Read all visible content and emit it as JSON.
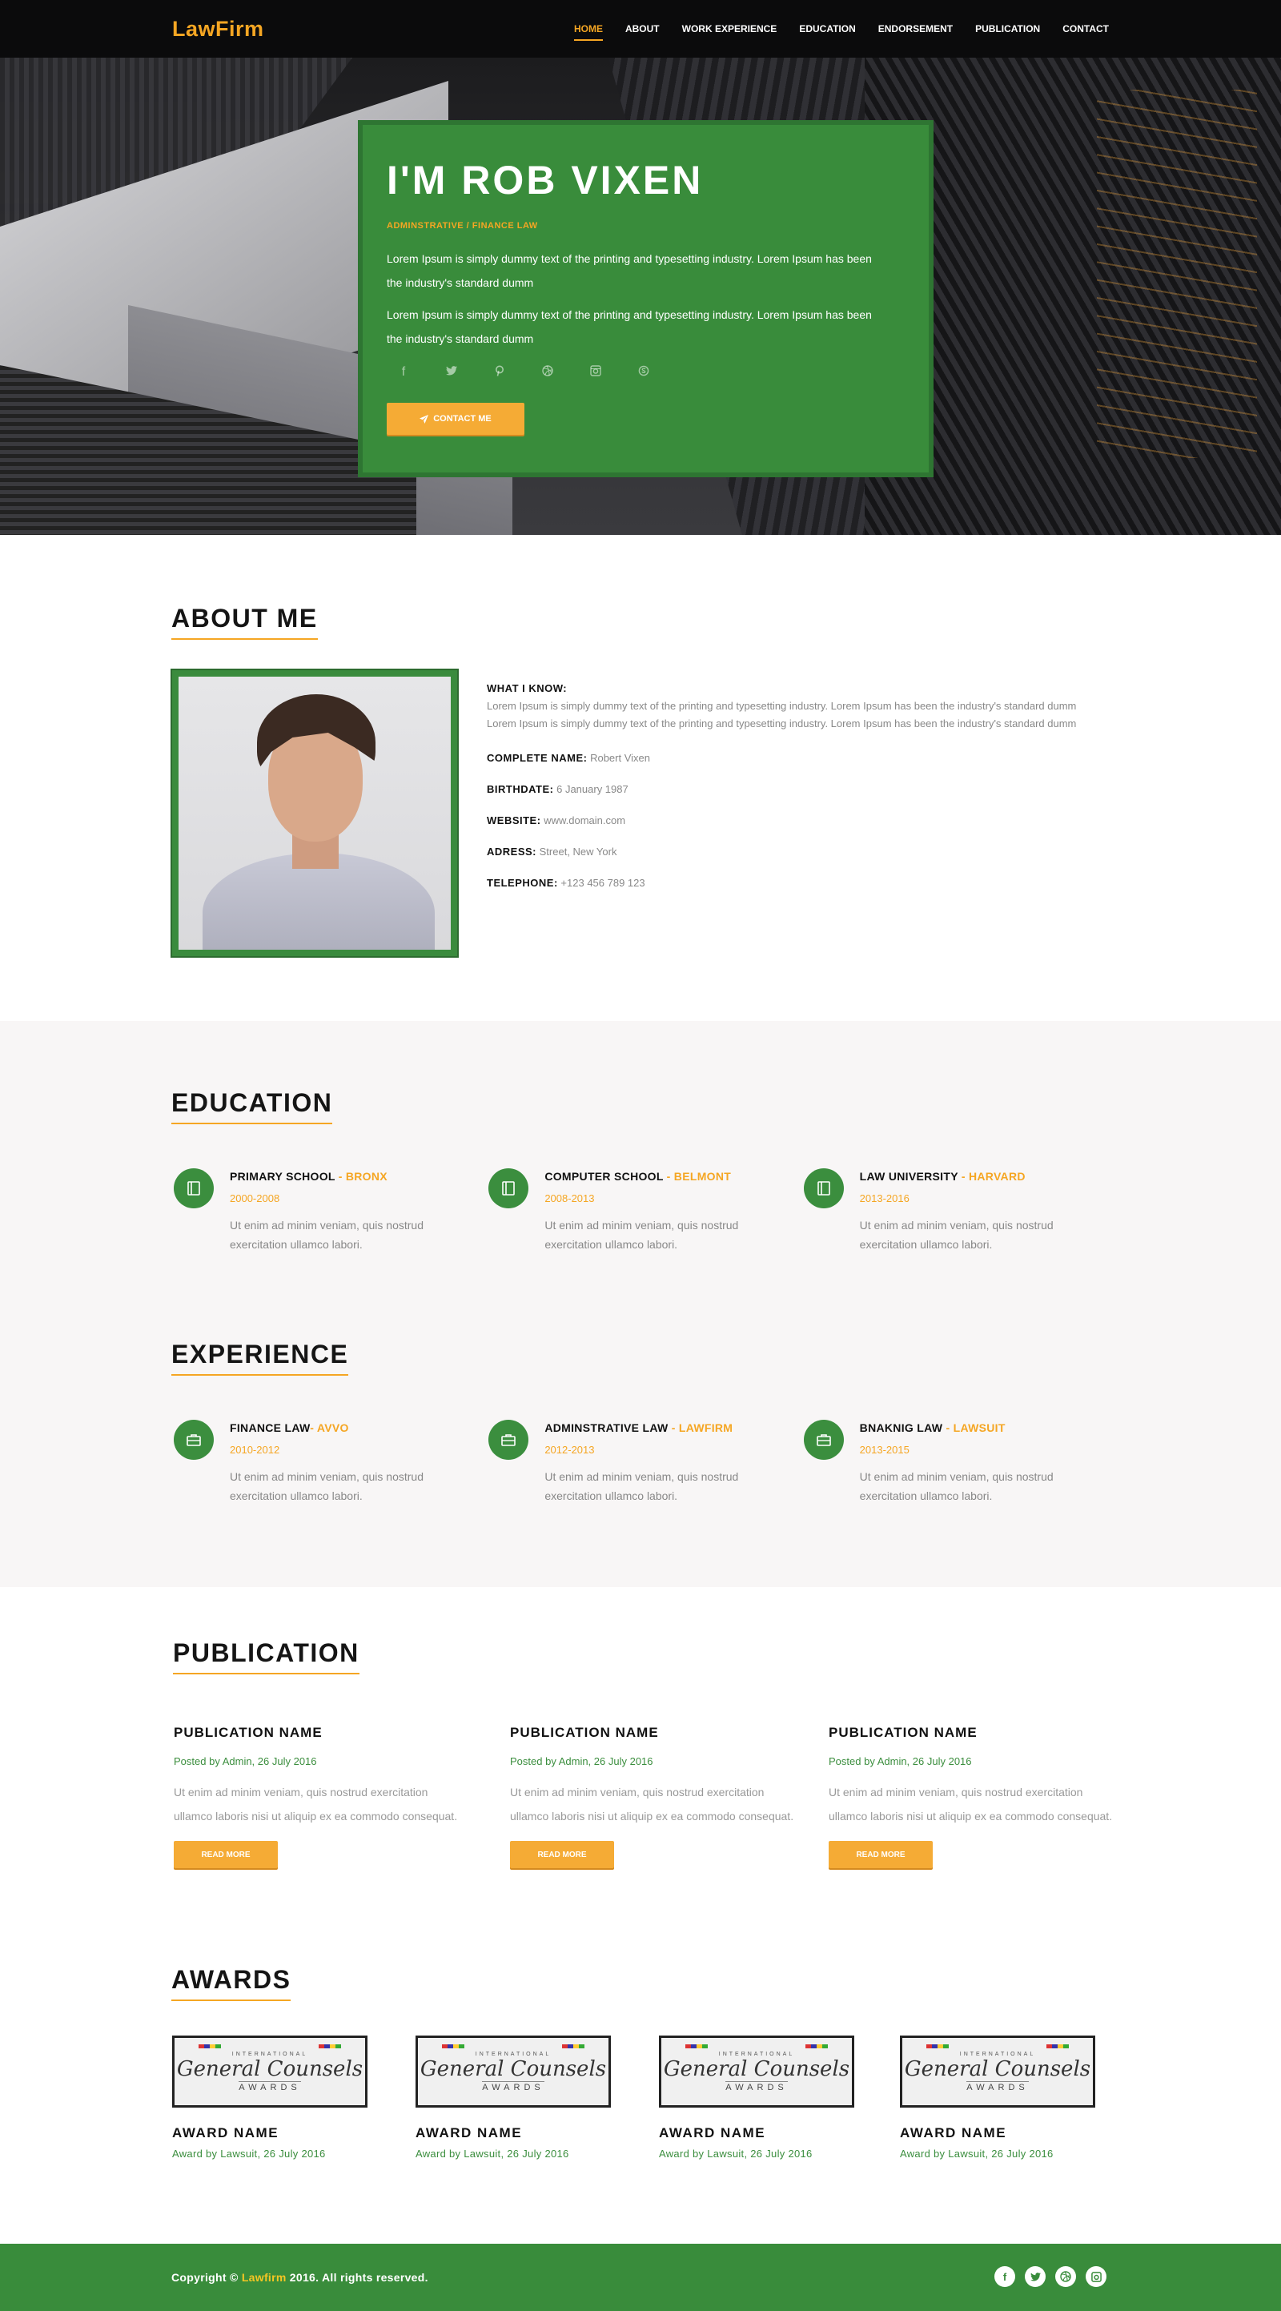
{
  "brand": {
    "logo": "LawFirm"
  },
  "nav": {
    "items": [
      {
        "label": "HOME",
        "active": true
      },
      {
        "label": "ABOUT"
      },
      {
        "label": "WORK EXPERIENCE"
      },
      {
        "label": "EDUCATION"
      },
      {
        "label": "ENDORSEMENT"
      },
      {
        "label": "PUBLICATION"
      },
      {
        "label": "CONTACT"
      }
    ]
  },
  "hero": {
    "title": "I'M ROB VIXEN",
    "subtitle": "ADMINSTRATIVE / FINANCE LAW",
    "para1": "Lorem Ipsum is simply dummy text of the printing and typesetting industry. Lorem Ipsum has been the industry's standard dumm",
    "para2": "Lorem Ipsum is simply dummy text of the printing and typesetting industry. Lorem Ipsum has been the industry's standard dumm",
    "socials": [
      "facebook-icon",
      "twitter-icon",
      "pinterest-icon",
      "dribbble-icon",
      "instagram-icon",
      "skype-icon"
    ],
    "contact_label": "CONTACT ME"
  },
  "about": {
    "title": "ABOUT ME",
    "know_label": "WHAT I KNOW:",
    "know_text": "Lorem Ipsum is simply dummy text of the printing and typesetting industry. Lorem Ipsum has been the industry's standard dumm Lorem Ipsum is simply dummy text of the printing and typesetting industry. Lorem Ipsum has been the industry's standard dumm",
    "rows": [
      {
        "k": "COMPLETE NAME:",
        "v": "Robert Vixen"
      },
      {
        "k": "BIRTHDATE:",
        "v": "6 January 1987"
      },
      {
        "k": "WEBSITE:",
        "v": "www.domain.com"
      },
      {
        "k": "ADRESS:",
        "v": "Street, New York"
      },
      {
        "k": "TELEPHONE:",
        "v": "+123 456 789 123"
      }
    ]
  },
  "education": {
    "title": "EDUCATION",
    "items": [
      {
        "name": "PRIMARY SCHOOL",
        "org": " - BRONX",
        "years": "2000-2008",
        "text": "Ut enim ad minim veniam, quis nostrud exercitation ullamco labori."
      },
      {
        "name": "COMPUTER SCHOOL",
        "org": " - BELMONT",
        "years": "2008-2013",
        "text": "Ut enim ad minim veniam, quis nostrud exercitation ullamco labori."
      },
      {
        "name": "LAW UNIVERSITY",
        "org": " - HARVARD",
        "years": "2013-2016",
        "text": "Ut enim ad minim veniam, quis nostrud exercitation ullamco labori."
      }
    ]
  },
  "experience": {
    "title": "EXPERIENCE",
    "items": [
      {
        "name": "FINANCE LAW",
        "org": "- AVVO",
        "years": "2010-2012",
        "text": "Ut enim ad minim veniam, quis nostrud exercitation ullamco labori."
      },
      {
        "name": "ADMINSTRATIVE LAW",
        "org": " - LAWFIRM",
        "years": "2012-2013",
        "text": "Ut enim ad minim veniam, quis nostrud exercitation ullamco labori."
      },
      {
        "name": "BNAKNIG LAW",
        "org": " - LAWSUIT",
        "years": "2013-2015",
        "text": "Ut enim ad minim veniam, quis nostrud exercitation ullamco labori."
      }
    ]
  },
  "publication": {
    "title": "PUBLICATION",
    "items": [
      {
        "name": "PUBLICATION NAME",
        "meta": "Posted by Admin, 26 July 2016",
        "text": "Ut enim ad minim veniam, quis nostrud exercitation ullamco laboris nisi ut aliquip ex ea commodo consequat.",
        "button": "READ MORE"
      },
      {
        "name": "PUBLICATION NAME",
        "meta": "Posted by Admin, 26 July 2016",
        "text": "Ut enim ad minim veniam, quis nostrud exercitation ullamco laboris nisi ut aliquip ex ea commodo consequat.",
        "button": "READ MORE"
      },
      {
        "name": "PUBLICATION NAME",
        "meta": "Posted by Admin, 26 July 2016",
        "text": "Ut enim ad minim veniam, quis nostrud exercitation ullamco laboris nisi ut aliquip ex ea commodo consequat.",
        "button": "READ MORE"
      }
    ]
  },
  "awards": {
    "title": "AWARDS",
    "badge": {
      "top": "INTERNATIONAL",
      "main": "General Counsels",
      "bottom": "AWARDS"
    },
    "items": [
      {
        "name": "AWARD NAME",
        "meta": "Award by Lawsuit, 26 July 2016"
      },
      {
        "name": "AWARD NAME",
        "meta": "Award by Lawsuit, 26 July 2016"
      },
      {
        "name": "AWARD NAME",
        "meta": "Award by Lawsuit, 26 July 2016"
      },
      {
        "name": "AWARD NAME",
        "meta": "Award by Lawsuit, 26 July 2016"
      }
    ]
  },
  "footer": {
    "copy_prefix": "Copyright © ",
    "copy_brand": "Lawfirm",
    "copy_suffix": " 2016. All rights reserved.",
    "socials": [
      "facebook-icon",
      "twitter-icon",
      "dribbble-icon",
      "instagram-icon"
    ]
  }
}
